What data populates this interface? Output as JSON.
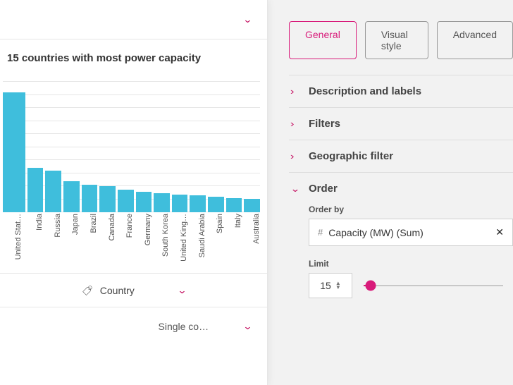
{
  "left": {
    "chart_title": "15 countries with most power capacity",
    "axis_label": "Country",
    "bottom_selector": "Single co…"
  },
  "right": {
    "tabs": {
      "general": "General",
      "visual": "Visual style",
      "advanced": "Advanced"
    },
    "sections": {
      "desc": "Description and labels",
      "filt": "Filters",
      "geo": "Geographic filter",
      "order": "Order"
    },
    "order": {
      "orderby_label": "Order by",
      "orderby_value": "Capacity (MW) (Sum)",
      "limit_label": "Limit",
      "limit_value": "15"
    }
  },
  "chart_data": {
    "type": "bar",
    "title": "15 countries with most power capacity",
    "xlabel": "Country",
    "ylabel": "",
    "categories": [
      "United Stat…",
      "India",
      "Russia",
      "Japan",
      "Brazil",
      "Canada",
      "France",
      "Germany",
      "South Korea",
      "United King…",
      "Saudi Arabia",
      "Spain",
      "Italy",
      "Australia"
    ],
    "values": [
      100,
      37,
      35,
      26,
      23,
      22,
      19,
      17,
      16,
      15,
      14,
      13,
      12,
      11
    ]
  }
}
